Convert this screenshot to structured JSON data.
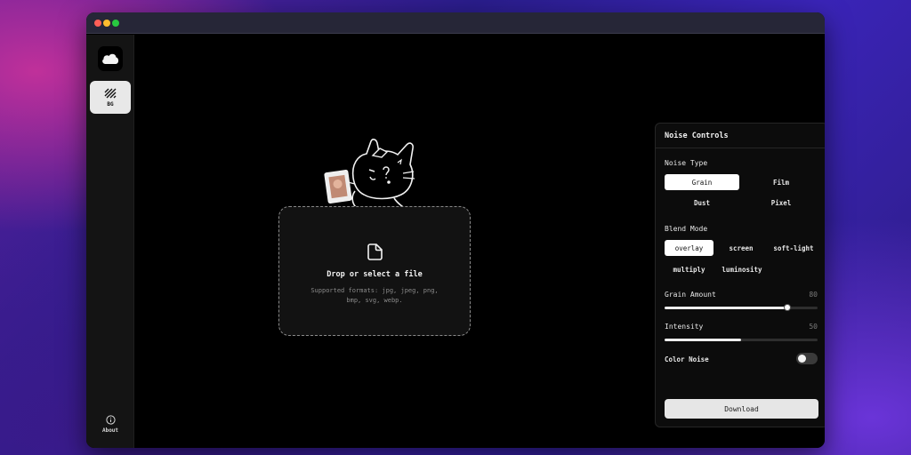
{
  "sidebar": {
    "logo_icon": "cloud-icon",
    "nav_bg_label": "BG",
    "about_label": "About"
  },
  "dropzone": {
    "title": "Drop or select a file",
    "subtitle": "Supported formats: jpg, jpeg, png, bmp, svg, webp."
  },
  "panel": {
    "title": "Noise Controls",
    "noise_type_label": "Noise Type",
    "noise_types": [
      "Grain",
      "Film",
      "Dust",
      "Pixel"
    ],
    "noise_type_selected": "Grain",
    "blend_mode_label": "Blend Mode",
    "blend_modes": [
      "overlay",
      "screen",
      "soft-light",
      "multiply",
      "luminosity"
    ],
    "blend_mode_selected": "overlay",
    "grain_amount_label": "Grain Amount",
    "grain_amount_value": "80",
    "intensity_label": "Intensity",
    "intensity_value": "50",
    "color_noise_label": "Color Noise",
    "color_noise_on": false,
    "download_label": "Download"
  },
  "colors": {
    "window_bg": "#000000",
    "sidebar_bg": "#141414",
    "accent": "#ffffff"
  }
}
